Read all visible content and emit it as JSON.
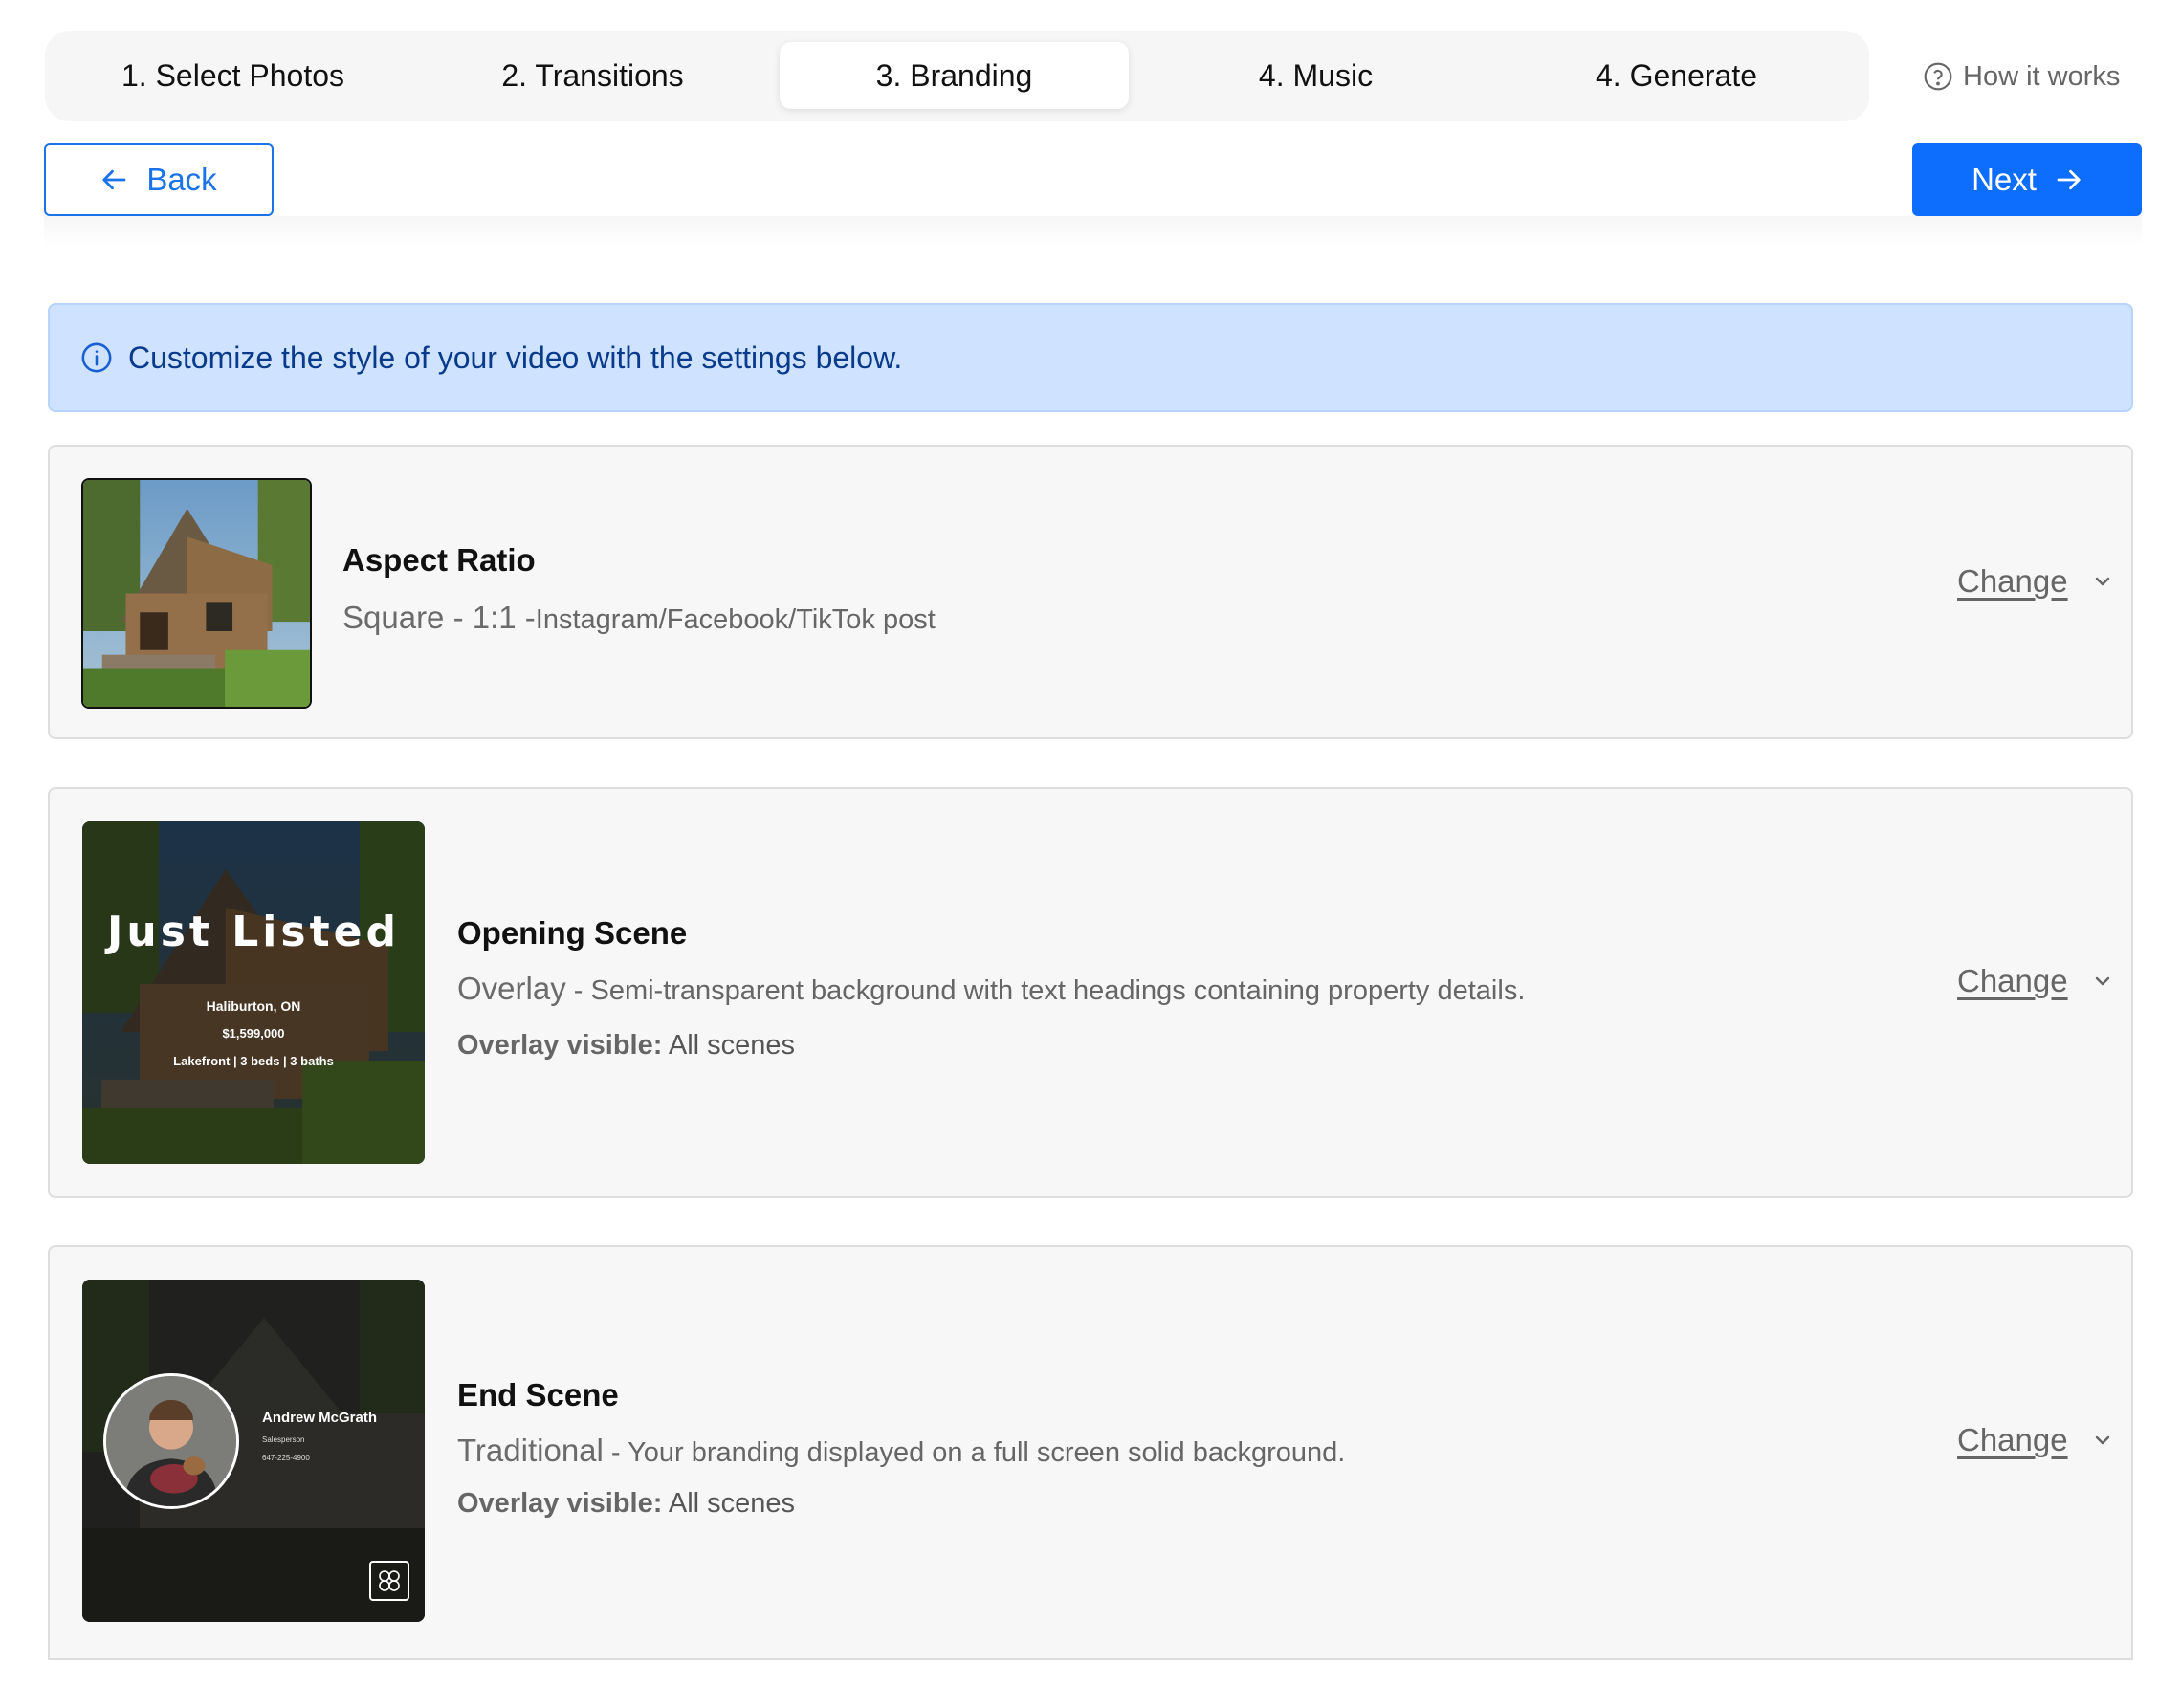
{
  "stepper": {
    "steps": [
      {
        "label": "1. Select Photos"
      },
      {
        "label": "2. Transitions"
      },
      {
        "label": "3. Branding"
      },
      {
        "label": "4. Music"
      },
      {
        "label": "4. Generate"
      }
    ],
    "active_index": 2,
    "help_label": "How it works"
  },
  "nav": {
    "back_label": "Back",
    "next_label": "Next"
  },
  "alert": {
    "text": "Customize the style of your video with the settings below."
  },
  "cards": [
    {
      "title": "Aspect Ratio",
      "value": "Square - 1:1 -",
      "detail": "Instagram/Facebook/TikTok post",
      "change_label": "Change"
    },
    {
      "title": "Opening Scene",
      "value": "Overlay",
      "detail": " - Semi-transparent background with text headings containing property details.",
      "visible_label": "Overlay visible:",
      "visible_value": "All scenes",
      "change_label": "Change",
      "overlay": {
        "headline": "Just Listed",
        "location": "Haliburton, ON",
        "price": "$1,599,000",
        "features": "Lakefront | 3 beds | 3 baths"
      }
    },
    {
      "title": "End Scene",
      "value": "Traditional",
      "detail": " - Your branding displayed on a full screen solid background.",
      "visible_label": "Overlay visible:",
      "visible_value": "All scenes",
      "change_label": "Change",
      "agent": {
        "name": "Andrew McGrath",
        "role": "Salesperson",
        "phone": "647-225-4900"
      }
    }
  ],
  "colors": {
    "primary": "#0d6efd",
    "alert_bg": "#cfe2ff",
    "alert_text": "#0a3a8c",
    "card_bg": "#f7f7f7"
  },
  "icons": [
    "question-circle-icon",
    "arrow-left-icon",
    "arrow-right-icon",
    "info-icon",
    "chevron-down-icon",
    "brokerage-logo-icon"
  ]
}
